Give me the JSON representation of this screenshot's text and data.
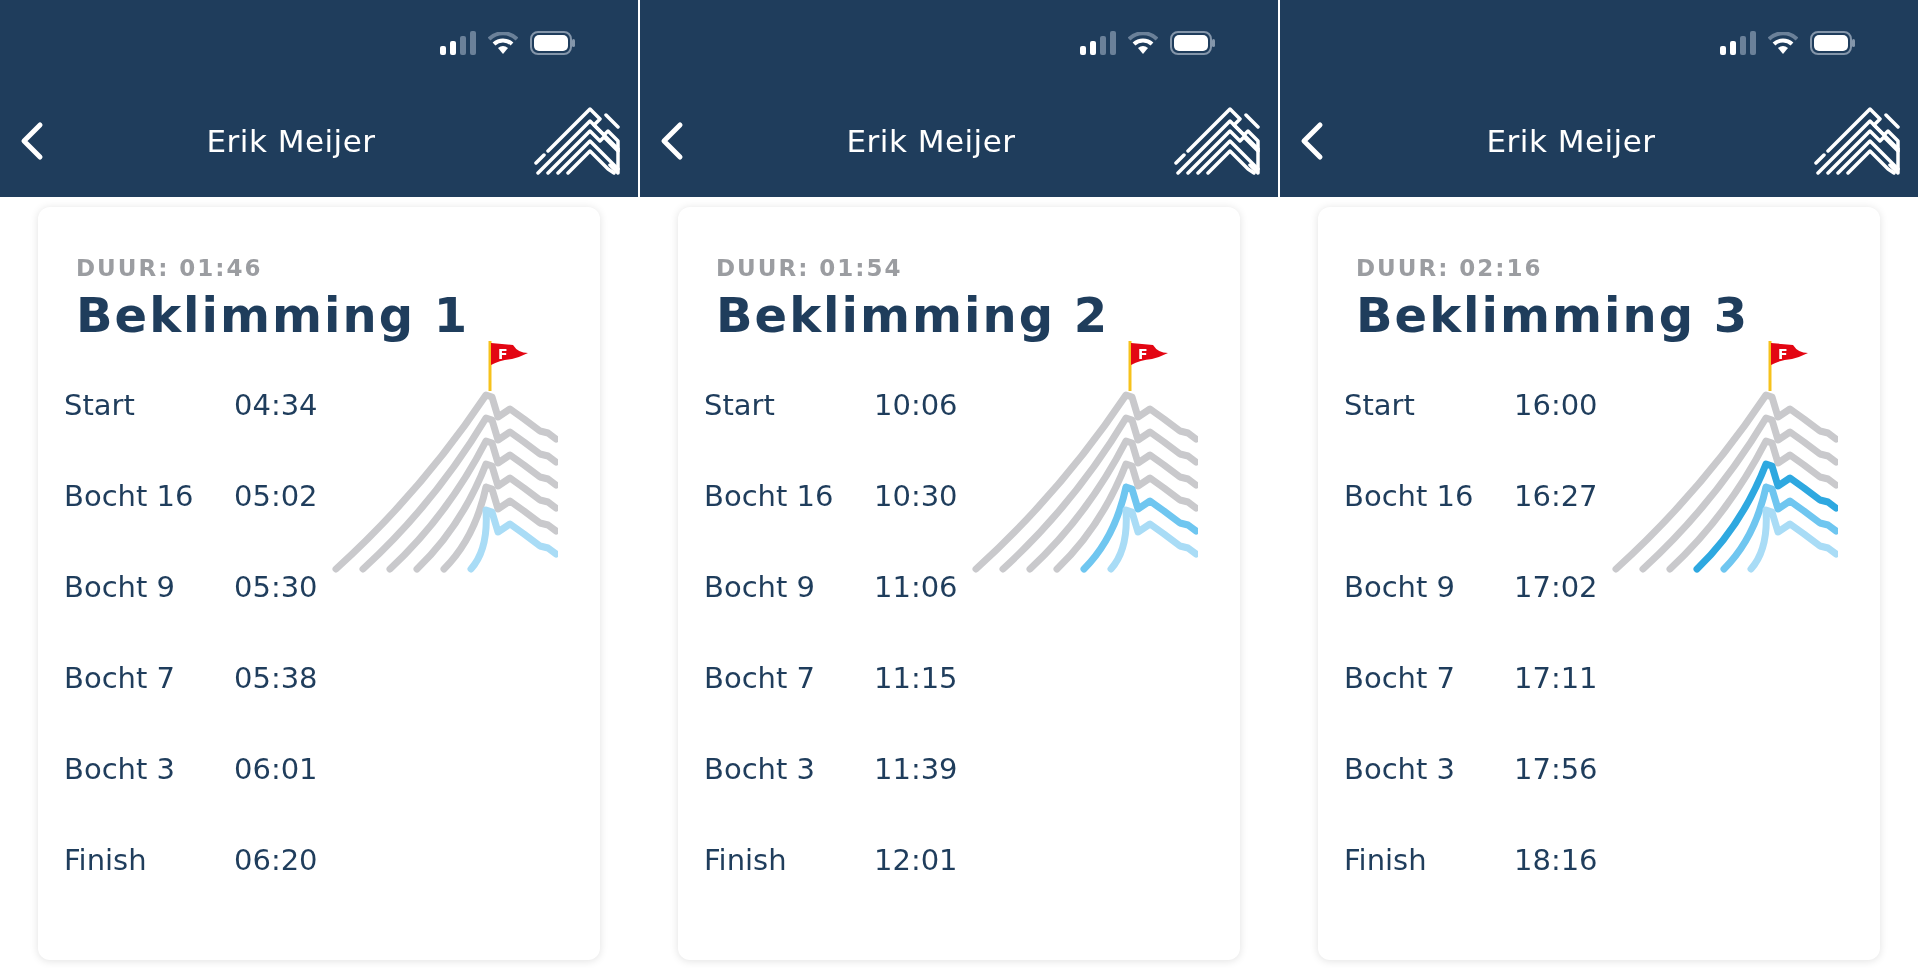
{
  "screens": [
    {
      "title": "Erik Meijer",
      "duration": "DUUR: 01:46",
      "climb": "Beklimming 1",
      "flag_label": "F",
      "layers": [
        {
          "reached": false
        },
        {
          "reached": false
        },
        {
          "reached": false
        },
        {
          "reached": false
        },
        {
          "reached": false
        },
        {
          "reached": true
        }
      ],
      "splits": [
        {
          "label": "Start",
          "time": "04:34"
        },
        {
          "label": "Bocht 16",
          "time": "05:02"
        },
        {
          "label": "Bocht 9",
          "time": "05:30"
        },
        {
          "label": "Bocht 7",
          "time": "05:38"
        },
        {
          "label": "Bocht 3",
          "time": "06:01"
        },
        {
          "label": "Finish",
          "time": "06:20"
        }
      ]
    },
    {
      "title": "Erik Meijer",
      "duration": "DUUR: 01:54",
      "climb": "Beklimming 2",
      "flag_label": "F",
      "layers": [
        {
          "reached": false
        },
        {
          "reached": false
        },
        {
          "reached": false
        },
        {
          "reached": false
        },
        {
          "reached": true
        },
        {
          "reached": true
        }
      ],
      "splits": [
        {
          "label": "Start",
          "time": "10:06"
        },
        {
          "label": "Bocht 16",
          "time": "10:30"
        },
        {
          "label": "Bocht 9",
          "time": "11:06"
        },
        {
          "label": "Bocht 7",
          "time": "11:15"
        },
        {
          "label": "Bocht 3",
          "time": "11:39"
        },
        {
          "label": "Finish",
          "time": "12:01"
        }
      ]
    },
    {
      "title": "Erik Meijer",
      "duration": "DUUR: 02:16",
      "climb": "Beklimming 3",
      "flag_label": "F",
      "layers": [
        {
          "reached": false
        },
        {
          "reached": false
        },
        {
          "reached": false
        },
        {
          "reached": true
        },
        {
          "reached": true
        },
        {
          "reached": true
        }
      ],
      "splits": [
        {
          "label": "Start",
          "time": "16:00"
        },
        {
          "label": "Bocht 16",
          "time": "16:27"
        },
        {
          "label": "Bocht 9",
          "time": "17:02"
        },
        {
          "label": "Bocht 7",
          "time": "17:11"
        },
        {
          "label": "Bocht 3",
          "time": "17:56"
        },
        {
          "label": "Finish",
          "time": "18:16"
        }
      ]
    }
  ]
}
